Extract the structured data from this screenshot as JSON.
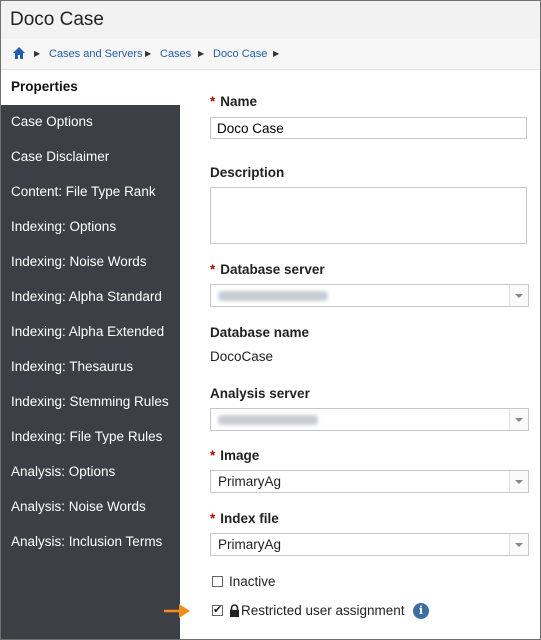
{
  "window": {
    "title": "Doco Case"
  },
  "breadcrumb": {
    "items": [
      "Cases and Servers",
      "Cases",
      "Doco Case"
    ]
  },
  "sidebar": {
    "items": [
      {
        "label": "Properties",
        "active": true
      },
      {
        "label": "Case Options"
      },
      {
        "label": "Case Disclaimer"
      },
      {
        "label": "Content: File Type Rank"
      },
      {
        "label": "Indexing: Options"
      },
      {
        "label": "Indexing: Noise Words"
      },
      {
        "label": "Indexing: Alpha Standard"
      },
      {
        "label": "Indexing: Alpha Extended"
      },
      {
        "label": "Indexing: Thesaurus"
      },
      {
        "label": "Indexing: Stemming Rules"
      },
      {
        "label": "Indexing: File Type Rules"
      },
      {
        "label": "Analysis: Options"
      },
      {
        "label": "Analysis: Noise Words"
      },
      {
        "label": "Analysis: Inclusion Terms"
      }
    ]
  },
  "form": {
    "required_marker": "*",
    "name": {
      "label": "Name",
      "value": "Doco Case"
    },
    "description": {
      "label": "Description",
      "value": ""
    },
    "database_server": {
      "label": "Database server"
    },
    "database_name": {
      "label": "Database name",
      "value": "DocoCase"
    },
    "analysis_server": {
      "label": "Analysis server"
    },
    "image": {
      "label": "Image",
      "value": "PrimaryAg"
    },
    "index_file": {
      "label": "Index file",
      "value": "PrimaryAg"
    },
    "inactive": {
      "label": "Inactive",
      "checked": false
    },
    "restricted": {
      "label": "Restricted user assignment",
      "checked": true
    }
  },
  "colors": {
    "sidebar_bg": "#3c3f46",
    "link": "#1f5fb3",
    "required": "#c40000",
    "callout_arrow": "#f28c1c",
    "info": "#3a6ea5"
  },
  "icons": {
    "home": "home-icon",
    "lock": "lock-icon",
    "info": "info-icon",
    "callout": "arrow-right-icon"
  }
}
